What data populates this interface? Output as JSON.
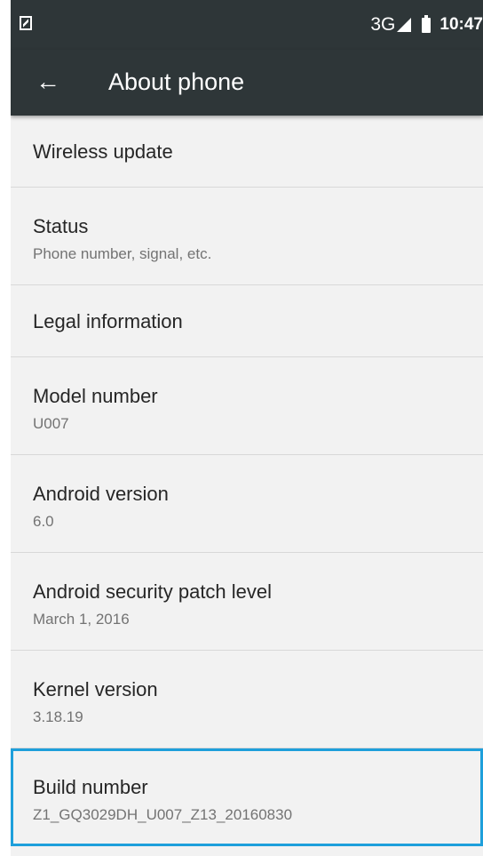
{
  "status_bar": {
    "network": "3G",
    "time": "10:47"
  },
  "app_bar": {
    "title": "About phone"
  },
  "items": [
    {
      "label": "Wireless update"
    },
    {
      "label": "Status",
      "sub": "Phone number, signal, etc."
    },
    {
      "label": "Legal information"
    },
    {
      "label": "Model number",
      "sub": "U007"
    },
    {
      "label": "Android version",
      "sub": "6.0"
    },
    {
      "label": "Android security patch level",
      "sub": "March 1, 2016"
    },
    {
      "label": "Kernel version",
      "sub": "3.18.19"
    },
    {
      "label": "Build number",
      "sub": "Z1_GQ3029DH_U007_Z13_20160830"
    }
  ],
  "colors": {
    "bar_background": "#2e3638",
    "page_background": "#f2f2f2",
    "selection_outline": "#1e9fdb"
  }
}
